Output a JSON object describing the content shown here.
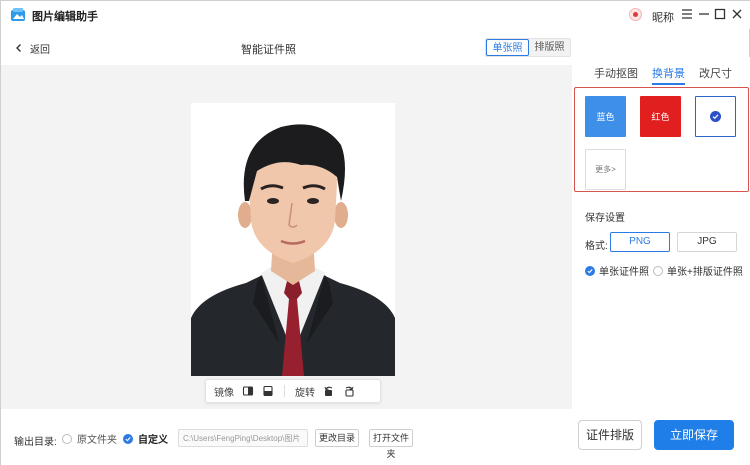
{
  "window": {
    "app_title": "图片编辑助手",
    "nickname": "昵称"
  },
  "header": {
    "back_label": "返回",
    "page_title": "智能证件照",
    "modes": [
      "单张照",
      "排版照"
    ],
    "active_mode": "单张照"
  },
  "image_toolbar": {
    "mirror_label": "镜像",
    "rotate_label": "旋转"
  },
  "side_panel": {
    "tabs": [
      "手动抠图",
      "换背景",
      "改尺寸"
    ],
    "active_tab": "换背景",
    "backgrounds": {
      "blue_label": "蓝色",
      "red_label": "红色",
      "more_label": "更多>",
      "selected": "white",
      "blue_color": "#3d8fe8",
      "red_color": "#e21f1f"
    },
    "save_settings": {
      "title": "保存设置",
      "format_label": "格式:",
      "formats": [
        "PNG",
        "JPG"
      ],
      "selected_format": "PNG",
      "option_single": "单张证件照",
      "option_both": "单张+排版证件照",
      "selected_option": "单张证件照"
    }
  },
  "bottom_bar": {
    "output_label": "输出目录:",
    "original_folder": "原文件夹",
    "custom": "自定义",
    "path_value": "C:\\Users\\FengPing\\Desktop\\图片",
    "change_dir": "更改目录",
    "open_folder": "打开文件夹",
    "layout_button": "证件排版",
    "save_button": "立即保存"
  },
  "colors": {
    "accent": "#2c7be5",
    "primary_button": "#1f7ee8",
    "highlight_border": "#d9534f"
  }
}
